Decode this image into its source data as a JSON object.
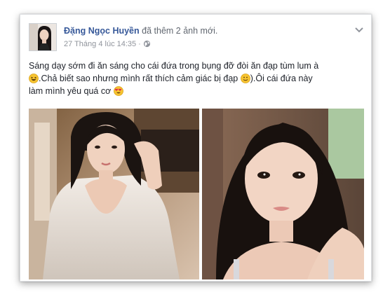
{
  "post": {
    "author": "Đặng Ngọc Huyền",
    "action_text": "đã thêm 2 ảnh mới.",
    "timestamp": "27 Tháng 4 lúc 14:35",
    "audience_icon": "globe-icon",
    "menu_icon": "chevron-down-icon",
    "text_line1": "Sáng dạy sớm đi ăn sáng cho cái đứa trong bụng đỡ đòi ăn đạp tùm lum à",
    "text_line2": ".Chả biết sao nhưng mình rất thích cảm giác bị đạp",
    "text_line2b": ").Ôi cái đứa này",
    "text_line3": "làm mình yêu quá cơ",
    "emoji_1": "laughing-emoji",
    "emoji_2": "smile-emoji",
    "emoji_3": "heart-eyes-emoji",
    "photos": [
      "photo-1",
      "photo-2"
    ]
  },
  "colors": {
    "author_link": "#365899",
    "secondary_text": "#616770",
    "meta_text": "#90949c",
    "body_text": "#1d2129"
  }
}
